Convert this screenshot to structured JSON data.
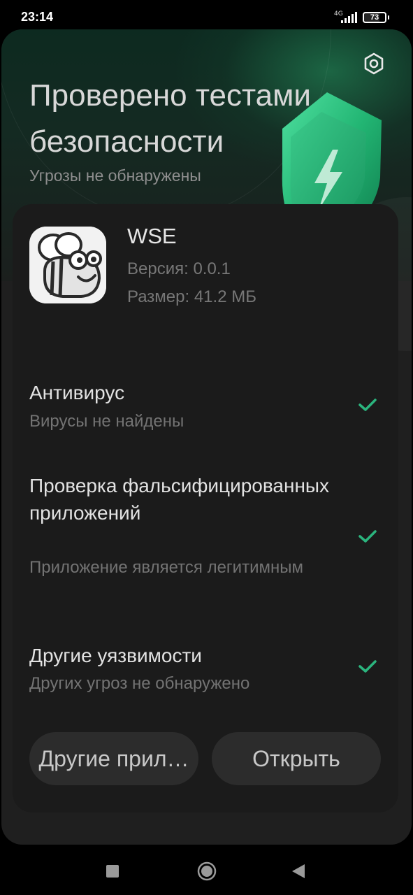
{
  "status_bar": {
    "time": "23:14",
    "network": "4G",
    "battery": "73",
    "battery_level": 0.73
  },
  "header": {
    "title": "Проверено тестами безопасности",
    "subtitle": "Угрозы не обнаружены",
    "settings_icon": "gear-hex-icon",
    "shield_icon": "shield-lightning-icon"
  },
  "app": {
    "name": "WSE",
    "version": "Версия: 0.0.1",
    "size": "Размер: 41.2 МБ",
    "icon": "bee-icon"
  },
  "checks": [
    {
      "title": "Антивирус",
      "description": "Вирусы не найдены",
      "status": "check-icon"
    },
    {
      "title": "Проверка фальсифицированных приложений",
      "description": "Приложение является легитимным",
      "status": "check-icon"
    },
    {
      "title": "Другие уязвимости",
      "description": "Других угроз не обнаружено",
      "status": "check-icon"
    }
  ],
  "buttons": {
    "other_apps": "Другие прил…",
    "open": "Открыть"
  },
  "nav": {
    "recents": "square-icon",
    "home": "circle-icon",
    "back": "triangle-back-icon"
  },
  "colors": {
    "accent": "#2bb57e",
    "background": "#1f1f1f",
    "button": "#2c2c2c"
  }
}
